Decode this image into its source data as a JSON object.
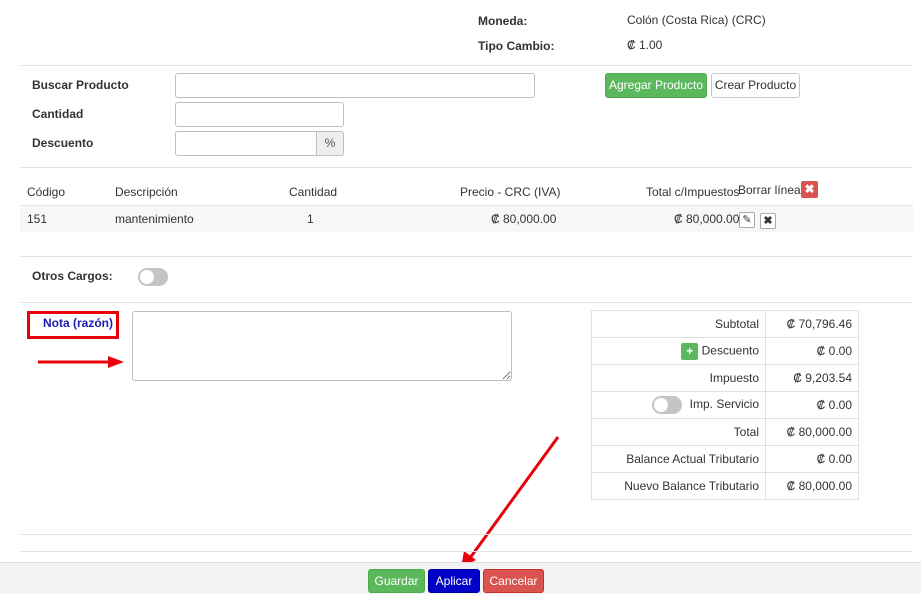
{
  "header": {
    "currency_label": "Moneda:",
    "currency_value": "Colón (Costa Rica) (CRC)",
    "exchange_label": "Tipo Cambio:",
    "exchange_value": "₡ 1.00"
  },
  "product_form": {
    "search_label": "Buscar Producto",
    "search_value": "",
    "quantity_label": "Cantidad",
    "quantity_value": "",
    "discount_label": "Descuento",
    "discount_value": "",
    "percent_addon": "%",
    "add_button": "Agregar Producto",
    "create_button": "Crear Producto"
  },
  "lines_table": {
    "headers": {
      "code": "Código",
      "description": "Descripción",
      "quantity": "Cantidad",
      "price": "Precio - CRC (IVA)",
      "total": "Total c/Impuestos",
      "delete_lines": "Borrar líneas"
    },
    "rows": [
      {
        "code": "151",
        "description": "mantenimiento",
        "quantity": "1",
        "price": "₡ 80,000.00",
        "total": "₡ 80,000.00"
      }
    ]
  },
  "other_charges": {
    "label": "Otros Cargos:",
    "enabled": false
  },
  "note": {
    "label": "Nota (razón)",
    "value": ""
  },
  "totals": {
    "subtotal_label": "Subtotal",
    "subtotal_value": "₡ 70,796.46",
    "discount_label": "Descuento",
    "discount_value": "₡ 0.00",
    "tax_label": "Impuesto",
    "tax_value": "₡ 9,203.54",
    "service_label": "Imp. Servicio",
    "service_value": "₡ 0.00",
    "service_enabled": false,
    "total_label": "Total",
    "total_value": "₡ 80,000.00",
    "balance_label": "Balance Actual Tributario",
    "balance_value": "₡ 0.00",
    "new_balance_label": "Nuevo Balance Tributario",
    "new_balance_value": "₡ 80,000.00"
  },
  "footer": {
    "save_button": "Guardar",
    "apply_button": "Aplicar",
    "cancel_button": "Cancelar"
  },
  "colors": {
    "green": "#5cb85c",
    "blue": "#0000c8",
    "red": "#d9534f",
    "annotation": "#e8000b"
  },
  "icons": {
    "delete_all": "close-icon",
    "edit": "pencil-icon",
    "delete_row": "close-icon",
    "add_discount": "plus-icon"
  }
}
